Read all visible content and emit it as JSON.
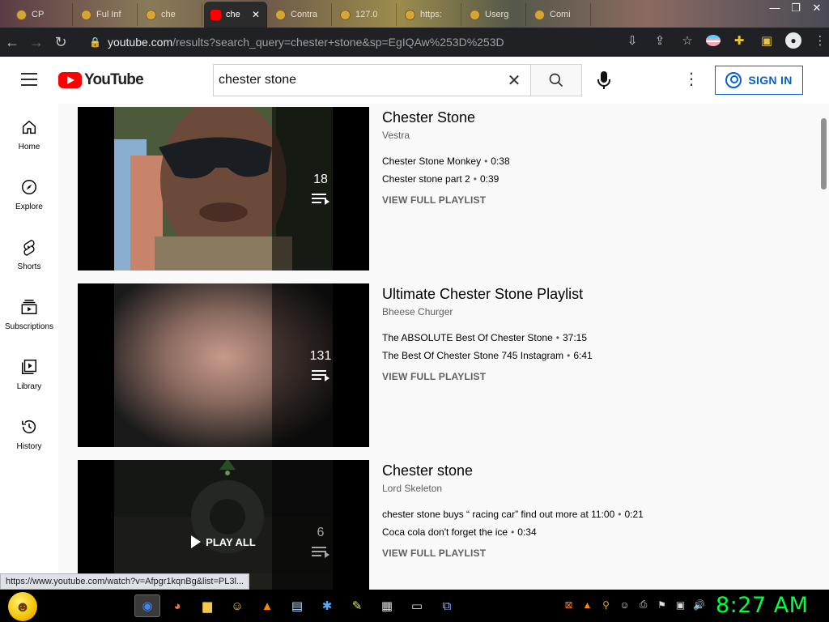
{
  "browser": {
    "tabs": [
      {
        "label": "CP"
      },
      {
        "label": "Ful Inf"
      },
      {
        "label": "che",
        "active": true
      },
      {
        "label": "Contra"
      },
      {
        "label": "127.0"
      },
      {
        "label": "https:"
      },
      {
        "label": "Userg"
      },
      {
        "label": "Comi"
      }
    ],
    "url_host": "youtube.com",
    "url_path": "/results?search_query=chester+stone&sp=EgIQAw%253D%253D",
    "status_url": "https://www.youtube.com/watch?v=Afpgr1kqnBg&list=PL3l..."
  },
  "youtube": {
    "logo_text": "YouTube",
    "search_query": "chester stone",
    "signin_label": "SIGN IN",
    "brand_color": "#ff0000",
    "link_color": "#065fd4"
  },
  "guide": [
    {
      "label": "Home",
      "icon": "home-icon"
    },
    {
      "label": "Explore",
      "icon": "compass-icon"
    },
    {
      "label": "Shorts",
      "icon": "shorts-icon"
    },
    {
      "label": "Subscriptions",
      "icon": "subscriptions-icon"
    },
    {
      "label": "Library",
      "icon": "library-icon"
    },
    {
      "label": "History",
      "icon": "history-icon"
    }
  ],
  "results": [
    {
      "title": "Chester Stone",
      "channel": "Vestra",
      "count": "18",
      "videos": [
        {
          "title": "Chester Stone Monkey",
          "duration": "0:38"
        },
        {
          "title": "Chester stone part 2",
          "duration": "0:39"
        }
      ],
      "view_full": "VIEW FULL PLAYLIST"
    },
    {
      "title": "Ultimate Chester Stone Playlist",
      "channel": "Bheese Churger",
      "count": "131",
      "videos": [
        {
          "title": "The ABSOLUTE Best Of Chester Stone",
          "duration": "37:15"
        },
        {
          "title": "The Best Of Chester Stone 745 Instagram",
          "duration": "6:41"
        }
      ],
      "view_full": "VIEW FULL PLAYLIST"
    },
    {
      "title": "Chester stone",
      "channel": "Lord Skeleton",
      "count": "6",
      "play_all": "PLAY ALL",
      "videos": [
        {
          "title": "chester stone buys “ racing car” find out more at 11:00",
          "duration": "0:21"
        },
        {
          "title": "Coca cola don't forget the ice",
          "duration": "0:34"
        }
      ],
      "view_full": "VIEW FULL PLAYLIST"
    }
  ],
  "taskbar": {
    "clock": "8:27 AM",
    "clock_color": "#00ff40"
  }
}
